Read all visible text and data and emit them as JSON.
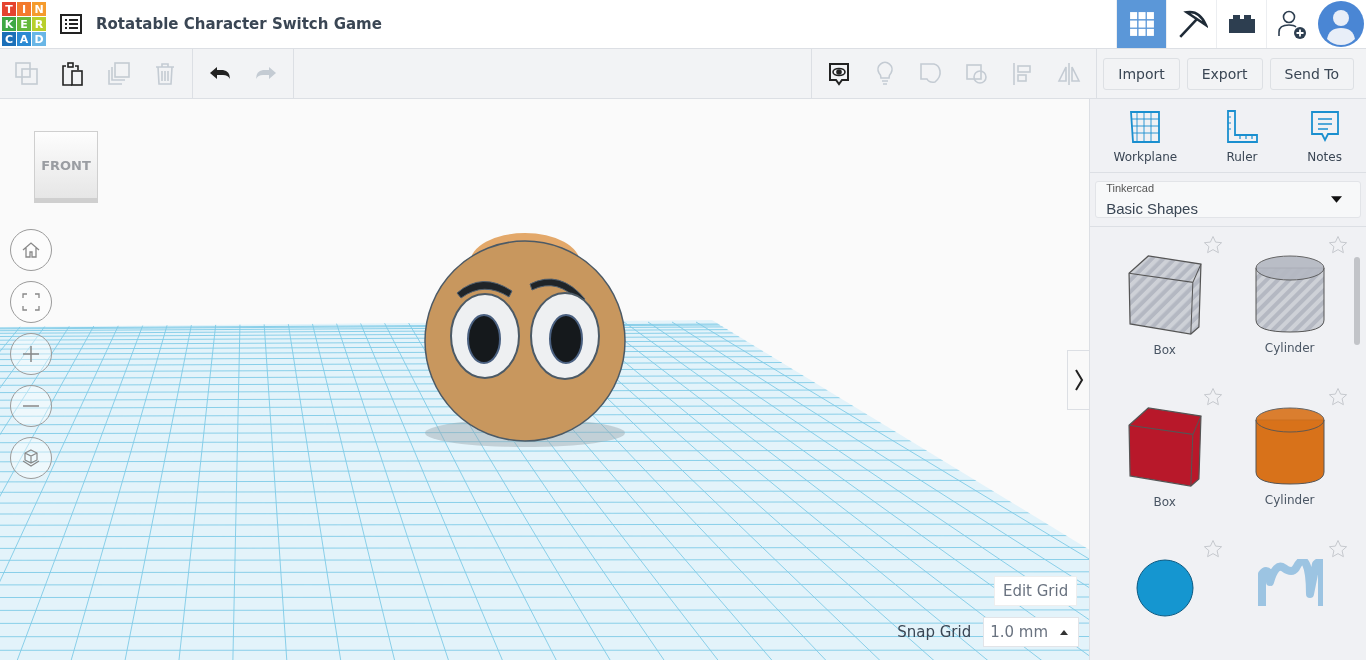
{
  "logo": {
    "letters": [
      {
        "text": "T",
        "color": "#e5432f"
      },
      {
        "text": "I",
        "color": "#f37a2e"
      },
      {
        "text": "N",
        "color": "#f59b2d"
      },
      {
        "text": "K",
        "color": "#3fa845"
      },
      {
        "text": "E",
        "color": "#66b83a"
      },
      {
        "text": "R",
        "color": "#b8cf2c"
      },
      {
        "text": "C",
        "color": "#1a6fb8"
      },
      {
        "text": "A",
        "color": "#2b8ad3"
      },
      {
        "text": "D",
        "color": "#69b6e6"
      }
    ]
  },
  "title": "Rotatable Character Switch Game",
  "top_nav": [
    {
      "kind": "grid",
      "selected": true
    },
    {
      "kind": "pickaxe",
      "selected": false
    },
    {
      "kind": "brick",
      "selected": false
    },
    {
      "kind": "add-user",
      "selected": false
    }
  ],
  "toolbar_left": [
    {
      "kind": "copy",
      "disabled": true
    },
    {
      "kind": "paste",
      "disabled": false
    },
    {
      "kind": "duplicate",
      "disabled": true
    },
    {
      "kind": "delete",
      "disabled": true
    },
    {
      "kind": "undo",
      "disabled": false
    },
    {
      "kind": "redo",
      "disabled": true
    }
  ],
  "toolbar_right": [
    {
      "kind": "notes-view",
      "disabled": false
    },
    {
      "kind": "bulb",
      "disabled": true
    },
    {
      "kind": "group",
      "disabled": true
    },
    {
      "kind": "ungroup",
      "disabled": true
    },
    {
      "kind": "align",
      "disabled": true
    },
    {
      "kind": "mirror",
      "disabled": true
    }
  ],
  "buttons": [
    "Import",
    "Export",
    "Send To"
  ],
  "view_cube": {
    "face": "FRONT"
  },
  "panel_tools": [
    {
      "kind": "workplane",
      "label": "Workplane"
    },
    {
      "kind": "ruler",
      "label": "Ruler"
    },
    {
      "kind": "notes",
      "label": "Notes"
    }
  ],
  "shape_library": {
    "label": "Tinkercad",
    "value": "Basic Shapes"
  },
  "shapes": [
    {
      "kind": "box",
      "label": "Box",
      "color": "#b4b8c2",
      "hole": true
    },
    {
      "kind": "cylinder",
      "label": "Cylinder",
      "color": "#b4b8c2",
      "hole": true
    },
    {
      "kind": "box",
      "label": "Box",
      "color": "#b8182a",
      "hole": false
    },
    {
      "kind": "cylinder",
      "label": "Cylinder",
      "color": "#d8721a",
      "hole": false
    },
    {
      "kind": "sphere",
      "color": "#1596d0",
      "hole": false
    },
    {
      "kind": "scribble",
      "color": "#9cc4e2",
      "hole": false
    }
  ],
  "edit_grid": "Edit Grid",
  "snap_grid": {
    "label": "Snap Grid",
    "value": "1.0 mm"
  }
}
